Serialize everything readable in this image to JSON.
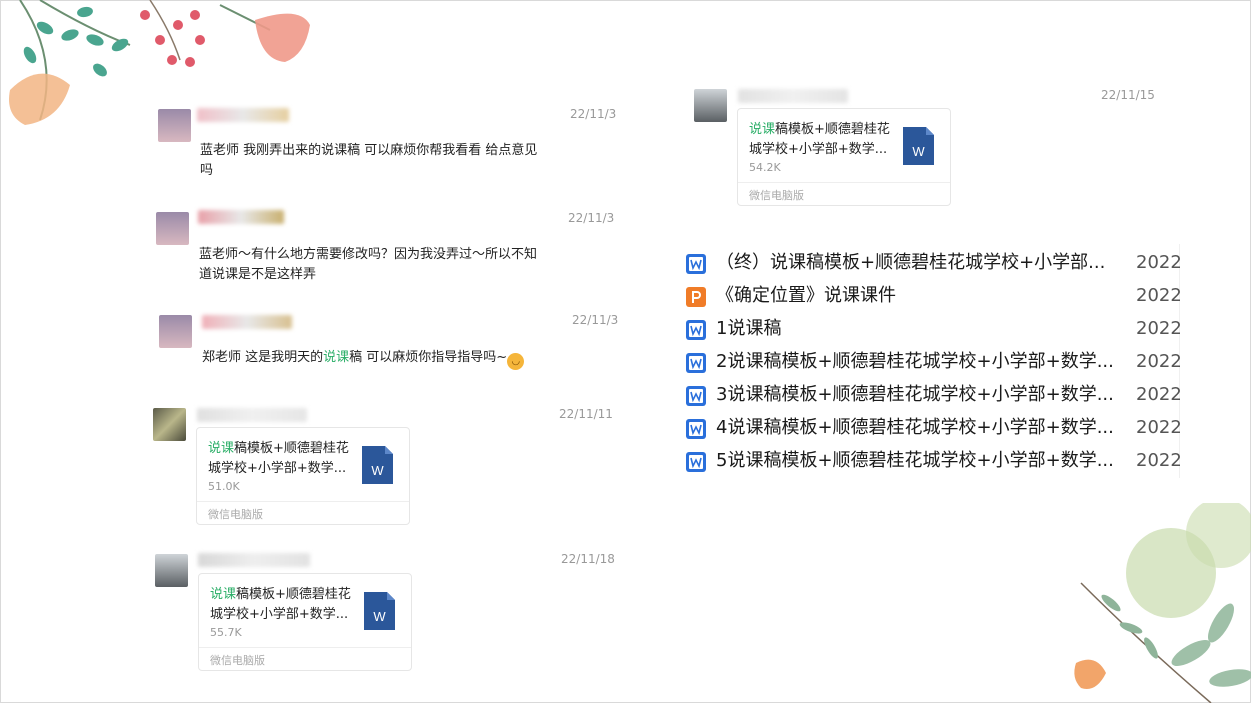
{
  "messages": [
    {
      "time": "22/11/3",
      "text": "蓝老师 我刚弄出来的说课稿 可以麻烦你帮我看看 给点意见吗"
    },
    {
      "time": "22/11/3",
      "text": "蓝老师～有什么地方需要修改吗？因为我没弄过～所以不知道说课是不是这样弄"
    },
    {
      "time": "22/11/3",
      "text_pre": "郑老师 这是我明天的",
      "text_hl": "说课",
      "text_post": "稿 可以麻烦你指导指导吗~"
    },
    {
      "time": "22/11/11",
      "file": {
        "name_hl": "说课",
        "name_rest": "稿模板+顺德碧桂花城学校+小学部+数学...",
        "size": "51.0K",
        "source": "微信电脑版"
      }
    },
    {
      "time": "22/11/18",
      "file": {
        "name_hl": "说课",
        "name_rest": "稿模板+顺德碧桂花城学校+小学部+数学...",
        "size": "55.7K",
        "source": "微信电脑版"
      }
    },
    {
      "time": "22/11/15",
      "file": {
        "name_hl": "说课",
        "name_rest": "稿模板+顺德碧桂花城学校+小学部+数学...",
        "size": "54.2K",
        "source": "微信电脑版"
      }
    }
  ],
  "file_list": [
    {
      "icon": "word-icon",
      "name": "（终）说课稿模板+顺德碧桂花城学校+小学部...",
      "date": "2022"
    },
    {
      "icon": "ppt-icon",
      "name": "《确定位置》说课课件",
      "date": "2022"
    },
    {
      "icon": "word-icon",
      "name": "1说课稿",
      "date": "2022"
    },
    {
      "icon": "word-icon",
      "name": "2说课稿模板+顺德碧桂花城学校+小学部+数学...",
      "date": "2022"
    },
    {
      "icon": "word-icon",
      "name": "3说课稿模板+顺德碧桂花城学校+小学部+数学...",
      "date": "2022"
    },
    {
      "icon": "word-icon",
      "name": "4说课稿模板+顺德碧桂花城学校+小学部+数学...",
      "date": "2022"
    },
    {
      "icon": "word-icon",
      "name": "5说课稿模板+顺德碧桂花城学校+小学部+数学...",
      "date": "2022"
    }
  ],
  "icons": {
    "word_label": "W",
    "emoji": "face-emoji-icon"
  },
  "colors": {
    "highlight": "#2aae67",
    "word_blue": "#2b579a",
    "list_word_blue": "#2a6fdb",
    "ppt_orange": "#f07c28"
  }
}
